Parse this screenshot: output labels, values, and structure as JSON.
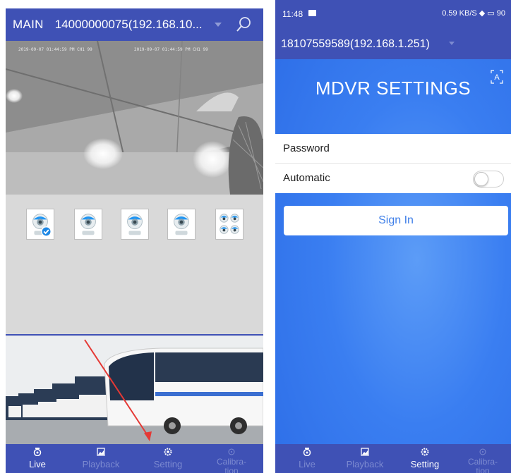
{
  "left_screen": {
    "header": {
      "mode": "MAIN",
      "device": "14000000075(192.168.10...",
      "search_icon": "search-icon"
    },
    "camera": {
      "osd_left": "2019-09-07 01:44:59 PM CH1 99",
      "osd_right": "2019-09-07 01:44:59 PM CH1 99"
    },
    "channels": [
      {
        "icon": "camera-selected-icon"
      },
      {
        "icon": "camera-icon"
      },
      {
        "icon": "camera-icon"
      },
      {
        "icon": "camera-icon"
      },
      {
        "icon": "quad-camera-icon"
      }
    ],
    "annotation": "red-arrow-pointing-to-setting",
    "nav": [
      {
        "label": "Live",
        "icon": "live-icon",
        "active": true
      },
      {
        "label": "Playback",
        "icon": "playback-icon",
        "active": false
      },
      {
        "label": "Setting",
        "icon": "setting-icon",
        "active": false
      },
      {
        "label": "Calibra-\ntion",
        "icon": "calibration-icon",
        "active": false
      }
    ]
  },
  "right_screen": {
    "status_bar": {
      "time": "11:48",
      "indicators": "0.59 KB/S ◆ ▭ 90"
    },
    "device": "18107559589(192.168.1.251)",
    "title": "MDVR SETTINGS",
    "language_icon": "language-a-icon",
    "form": {
      "password_label": "Password",
      "automatic_label": "Automatic",
      "automatic_on": false
    },
    "sign_in": "Sign In",
    "nav": [
      {
        "label": "Live",
        "icon": "live-icon",
        "active": false
      },
      {
        "label": "Playback",
        "icon": "playback-icon",
        "active": false
      },
      {
        "label": "Setting",
        "icon": "setting-icon",
        "active": true
      },
      {
        "label": "Calibra-\ntion",
        "icon": "calibration-icon",
        "active": false
      }
    ]
  },
  "colors": {
    "primary": "#3f51b5",
    "accent_blue": "#3a7ef1",
    "inactive_nav": "#7c8ad0",
    "arrow_red": "#e53935"
  }
}
